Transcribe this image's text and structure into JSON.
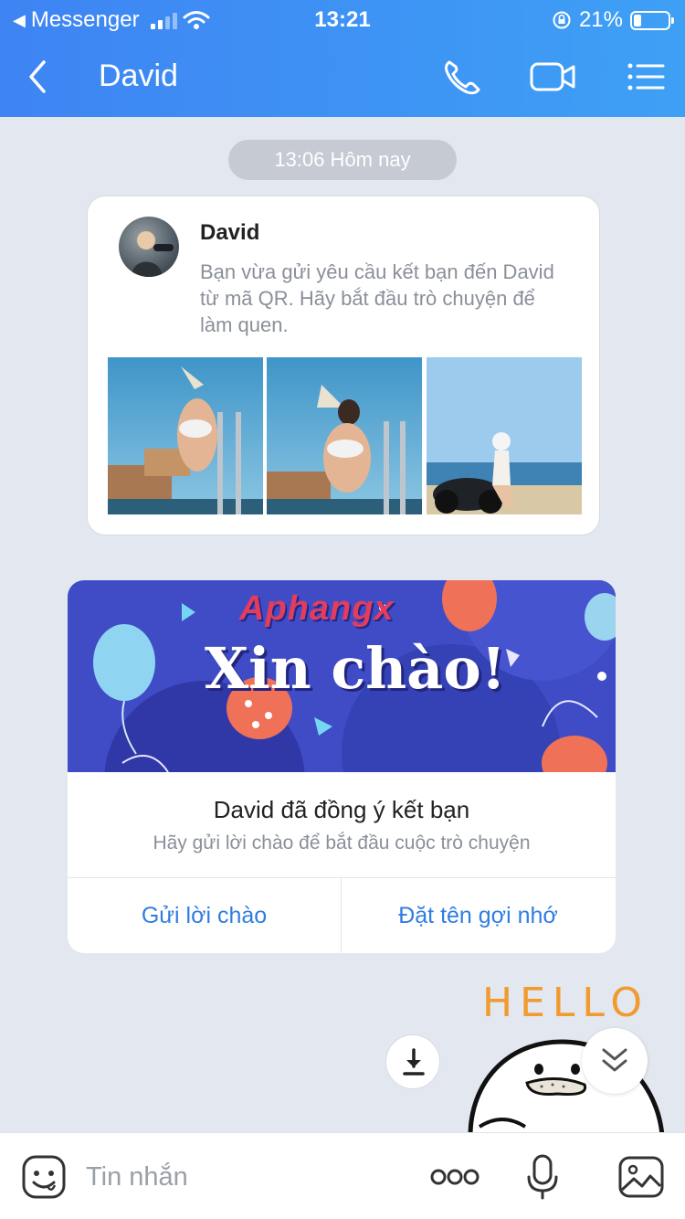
{
  "status_bar": {
    "back_app": "Messenger",
    "time": "13:21",
    "battery": "21%",
    "battery_level": 0.21
  },
  "header": {
    "title": "David",
    "icons": [
      "back-chevron-icon",
      "phone-icon",
      "video-call-icon",
      "menu-list-icon"
    ]
  },
  "chat": {
    "time_pill": "13:06 Hôm nay",
    "friend_request": {
      "name": "David",
      "message": "Bạn vừa gửi yêu cầu kết bạn đến David từ mã QR. Hãy bắt đầu trò chuyện để làm quen."
    },
    "accepted_card": {
      "banner_brand": "Aphangx",
      "banner_greeting": "Xin chào!",
      "title": "David đã đồng ý kết bạn",
      "subtitle": "Hãy gửi lời chào để bắt đầu cuộc trò chuyện",
      "btn_send_greeting": "Gửi lời chào",
      "btn_set_nickname": "Đặt tên gợi nhớ"
    },
    "sticker": {
      "text": "HELLO"
    }
  },
  "input_bar": {
    "placeholder": "Tin nhắn"
  },
  "colors": {
    "header_start": "#3e84f3",
    "header_end": "#3ea0f5",
    "link_blue": "#2f7de1",
    "chat_background": "#e3e7ef"
  }
}
